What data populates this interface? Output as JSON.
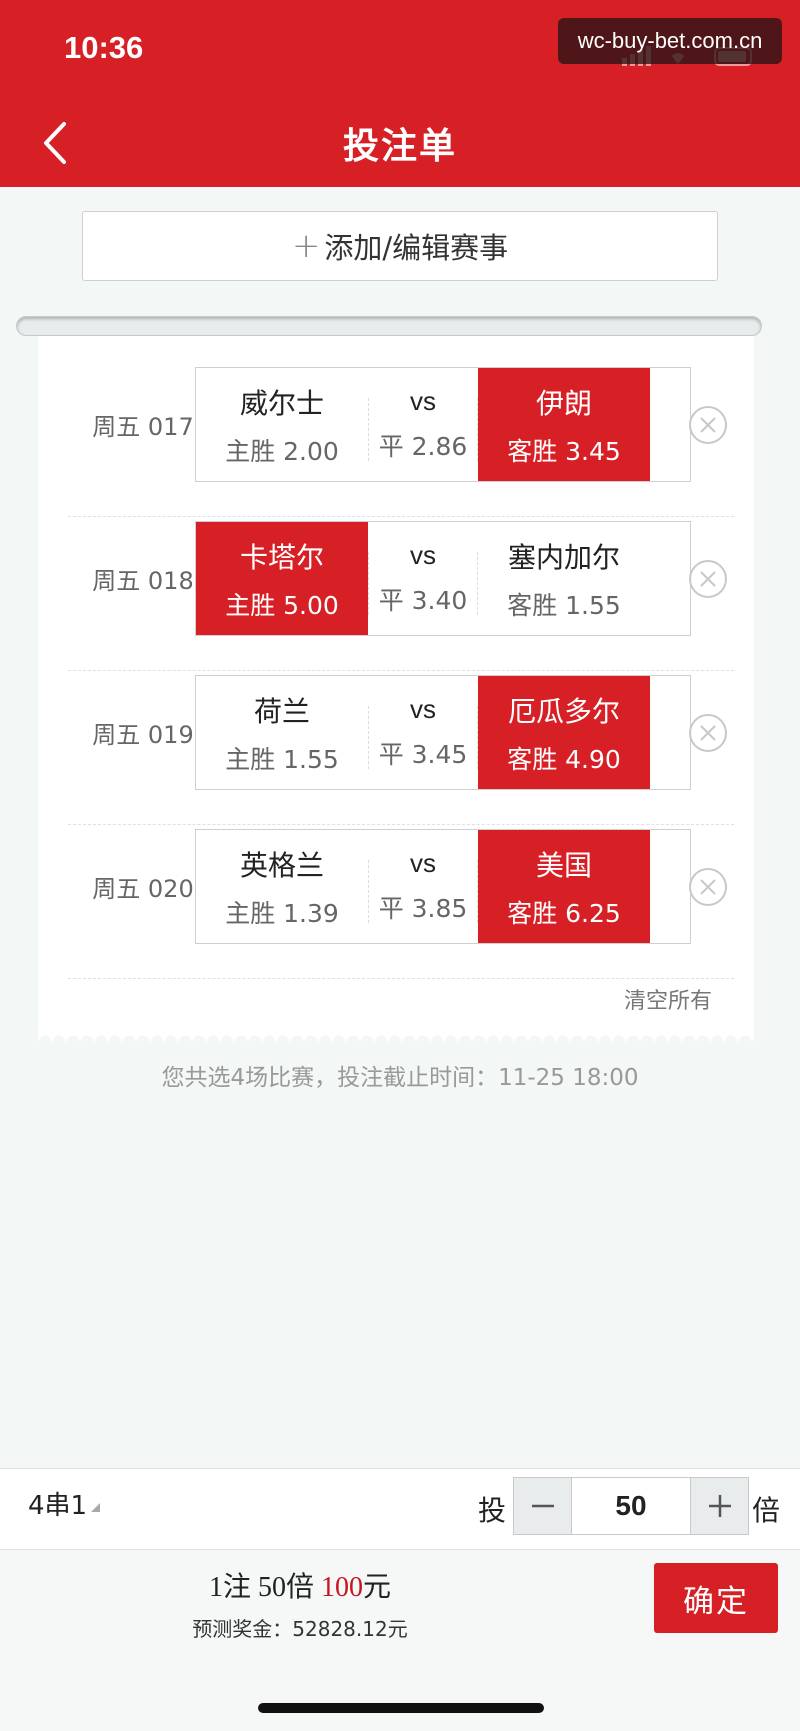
{
  "status_bar": {
    "time": "10:36"
  },
  "watermark": "wc-buy-bet.com.cn",
  "header": {
    "title": "投注单"
  },
  "add_button": {
    "label": "添加/编辑赛事"
  },
  "matches": [
    {
      "id": "周五 017",
      "home": "威尔士",
      "home_odds": "主胜 2.00",
      "vs": "vs",
      "draw_odds": "平 2.86",
      "away": "伊朗",
      "away_odds": "客胜 3.45",
      "selected": "away"
    },
    {
      "id": "周五 018",
      "home": "卡塔尔",
      "home_odds": "主胜 5.00",
      "vs": "vs",
      "draw_odds": "平 3.40",
      "away": "塞内加尔",
      "away_odds": "客胜 1.55",
      "selected": "home"
    },
    {
      "id": "周五 019",
      "home": "荷兰",
      "home_odds": "主胜 1.55",
      "vs": "vs",
      "draw_odds": "平 3.45",
      "away": "厄瓜多尔",
      "away_odds": "客胜 4.90",
      "selected": "away"
    },
    {
      "id": "周五 020",
      "home": "英格兰",
      "home_odds": "主胜 1.39",
      "vs": "vs",
      "draw_odds": "平 3.85",
      "away": "美国",
      "away_odds": "客胜 6.25",
      "selected": "away"
    }
  ],
  "clear_all": "清空所有",
  "summary": "您共选4场比赛，投注截止时间：11-25 18:00",
  "bet_bar": {
    "pass_type": "4串1",
    "mult_prefix": "投",
    "multiplier": "50",
    "mult_suffix": "倍"
  },
  "footer": {
    "bets": "1注 50倍",
    "amount": "100",
    "currency": "元",
    "prize_label": "预测奖金：",
    "prize_value": "52828.12元",
    "confirm": "确定"
  },
  "colors": {
    "brand_red": "#d71f26",
    "background": "#f3f7f6"
  }
}
